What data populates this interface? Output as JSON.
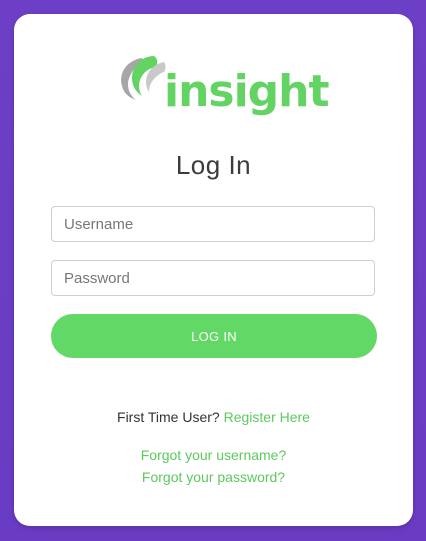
{
  "brand": {
    "logo_text": "insight",
    "logo_icon": "crescent-swoosh-icon",
    "accent_color": "#63d363",
    "mark_color": "#a6a6a6"
  },
  "page": {
    "title": "Log In",
    "background_color": "#6d3fc6"
  },
  "form": {
    "username_placeholder": "Username",
    "username_value": "",
    "password_placeholder": "Password",
    "password_value": "",
    "submit_label": "LOG IN",
    "submit_color": "#62d866"
  },
  "footer": {
    "first_time_text": "First Time User?",
    "register_link": "Register Here",
    "forgot_username": "Forgot your username?",
    "forgot_password": "Forgot your password?"
  }
}
